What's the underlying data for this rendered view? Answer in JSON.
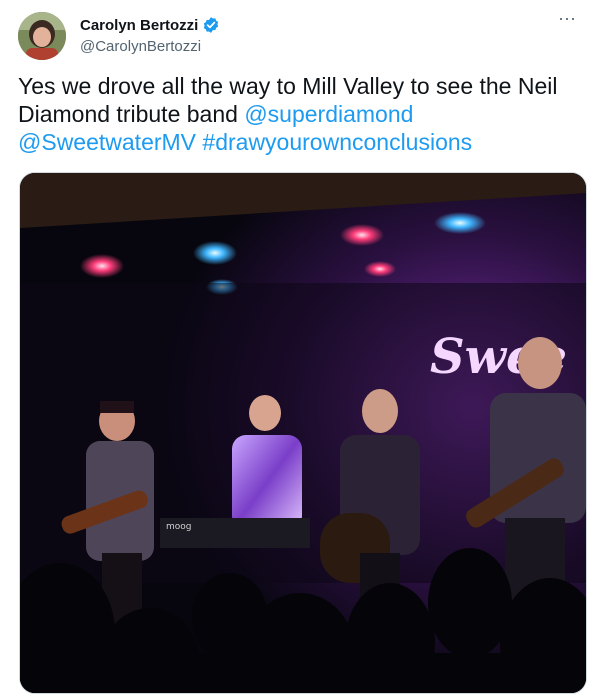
{
  "author": {
    "display_name": "Carolyn Bertozzi",
    "handle": "@CarolynBertozzi",
    "verified": true
  },
  "more_menu_label": "···",
  "tweet": {
    "text_plain": "Yes we drove all the way to Mill Valley to see the Neil Diamond tribute band ",
    "mention_1": "@superdiamond",
    "mention_2": "@SweetwaterMV",
    "hashtag": "#drawyourownconclusions"
  },
  "media": {
    "venue_sign_text": "Swee",
    "keyboard_brand_text": "moog"
  },
  "colors": {
    "link": "#1d9bf0",
    "text": "#0f1419",
    "secondary": "#536471",
    "verified": "#1d9bf0"
  }
}
